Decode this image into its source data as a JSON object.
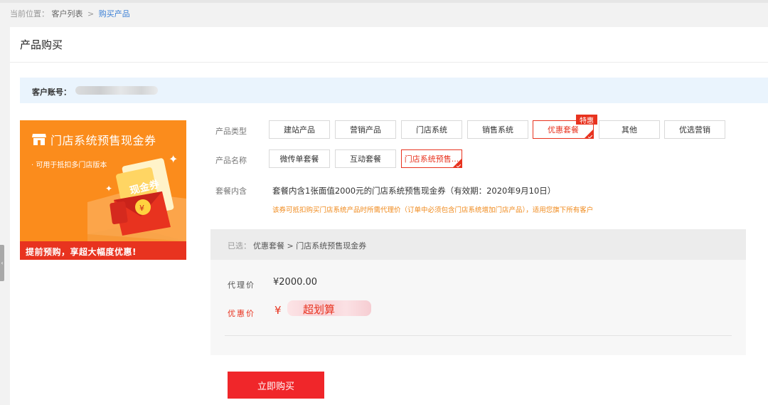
{
  "breadcrumb": {
    "prefix": "当前位置：",
    "parent": "客户列表",
    "separator": ">",
    "current": "购买产品"
  },
  "panel": {
    "title": "产品购买"
  },
  "account": {
    "label": "客户账号："
  },
  "banner": {
    "title": "门店系统预售现金券",
    "subtitle": "· 可用于抵扣多门店版本",
    "coupon_text": "现金券",
    "bottom_text": "提前预购，享超大幅度优惠!"
  },
  "product_type": {
    "label": "产品类型",
    "options": [
      "建站产品",
      "营销产品",
      "门店系统",
      "销售系统",
      "优惠套餐",
      "其他",
      "优选营销"
    ],
    "selected": "优惠套餐",
    "badge": "特惠"
  },
  "product_name": {
    "label": "产品名称",
    "options": [
      "微传单套餐",
      "互动套餐",
      "门店系统预售..."
    ],
    "selected": "门店系统预售..."
  },
  "package": {
    "label": "套餐内含",
    "content": "套餐内含1张面值2000元的门店系统预售现金券（有效期：2020年9月10日）",
    "notice": "该券可抵扣购买门店系统产品时所需代理价（订单中必须包含门店系统增加门店产品），适用您旗下所有客户"
  },
  "summary": {
    "selected_label": "已选：",
    "selected_path": "优惠套餐 > 门店系统预售现金券",
    "agent_price_label": "代理价",
    "agent_price": "¥2000.00",
    "promo_price_label": "优惠价",
    "promo_currency": "¥",
    "promo_text": "超划算"
  },
  "buy_button": {
    "label": "立即购买"
  },
  "colors": {
    "accent": "#e8331f",
    "banner": "#fb8c1c",
    "link": "#3a7fd5",
    "notice": "#f08a1c",
    "button": "#f0262a"
  }
}
